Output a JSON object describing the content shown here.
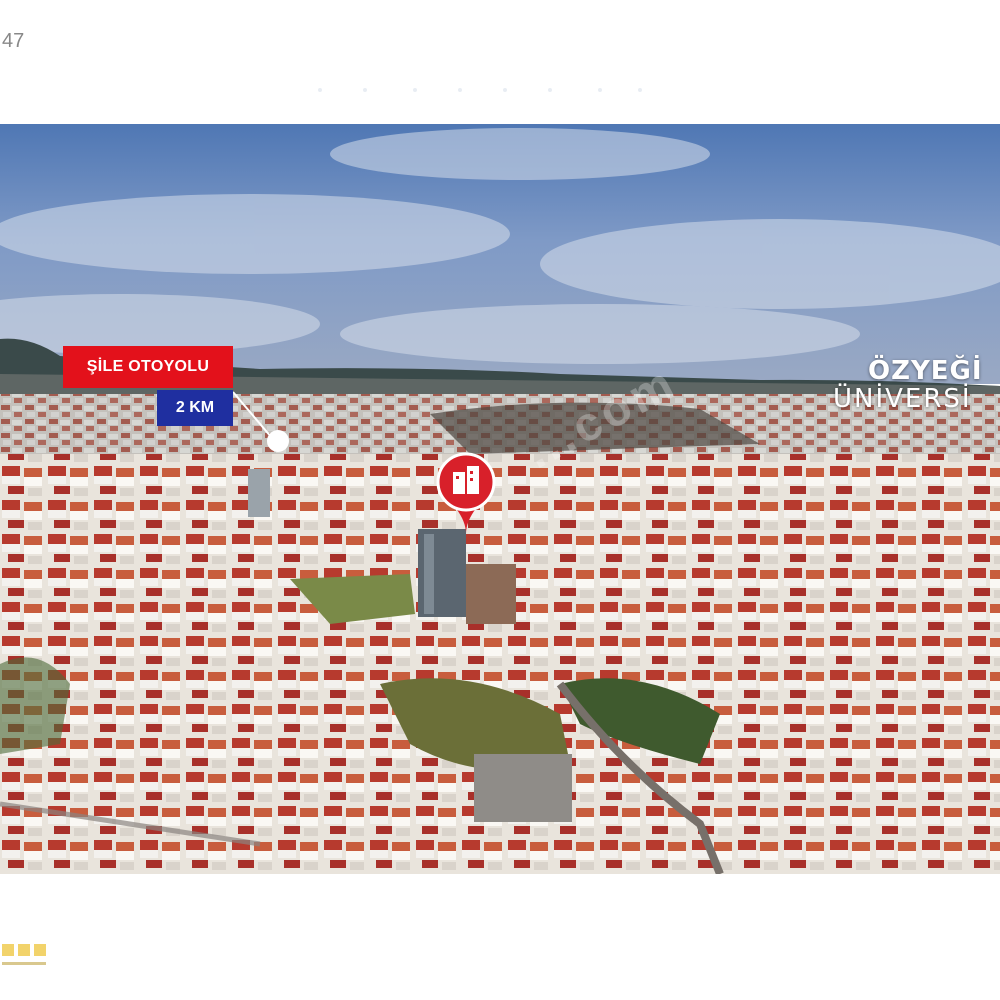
{
  "corner_number": "47",
  "road_label": {
    "name": "ŞİLE OTOYOLU",
    "distance": "2 KM"
  },
  "university_label": {
    "line1": "ÖZYEĞİ",
    "line2": "ÜNİVERSİ"
  },
  "watermark_text": "...com",
  "colors": {
    "road_red": "#e3111b",
    "distance_blue": "#1f2fa0",
    "pin_red": "#d8202a"
  },
  "icons": {
    "location_pin": "building-pin-icon"
  }
}
